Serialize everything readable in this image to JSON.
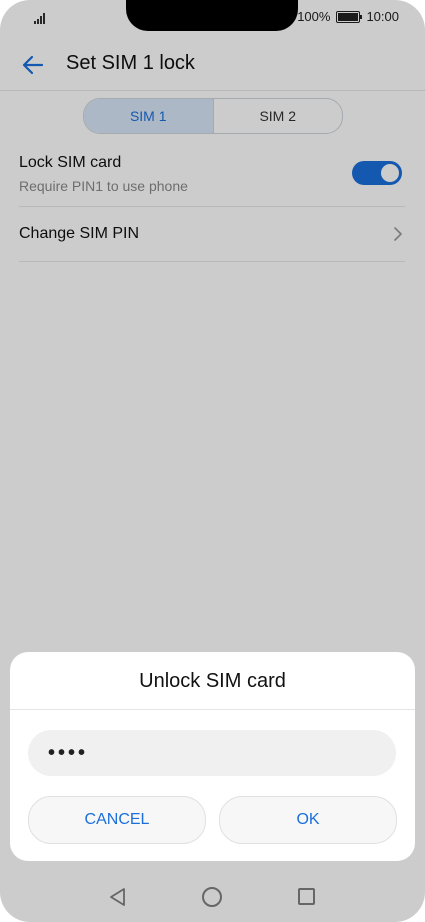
{
  "status": {
    "battery": "100%",
    "time": "10:00"
  },
  "header": {
    "title": "Set SIM 1 lock",
    "back_icon": "arrow-back-icon"
  },
  "tabs": [
    {
      "label": "SIM 1",
      "active": true
    },
    {
      "label": "SIM 2",
      "active": false
    }
  ],
  "settings": {
    "lock_sim": {
      "title": "Lock SIM card",
      "subtitle": "Require PIN1 to use phone",
      "toggle_on": true
    },
    "change_pin": {
      "title": "Change SIM PIN"
    }
  },
  "dialog": {
    "title": "Unlock SIM card",
    "pin_value": "••••",
    "cancel_label": "CANCEL",
    "ok_label": "OK"
  },
  "colors": {
    "accent": "#1a6fdc",
    "tab_active_bg": "#d8e6f8"
  },
  "icons": {
    "signal": "signal-icon",
    "battery": "battery-icon",
    "chevron": "chevron-right-icon",
    "nav_back": "nav-back-icon",
    "nav_home": "nav-home-icon",
    "nav_recents": "nav-recents-icon"
  }
}
